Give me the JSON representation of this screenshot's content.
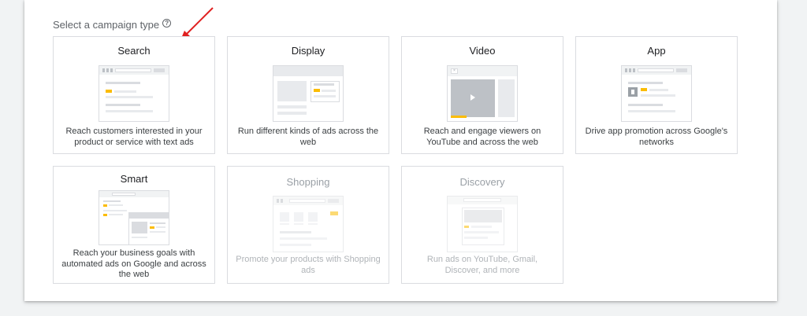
{
  "heading": "Select a campaign type",
  "colors": {
    "accent_yellow": "#fbbc04",
    "arrow_red": "#e02020",
    "border": "#dadce0",
    "disabled_text": "#9aa0a6"
  },
  "campaign_types": [
    {
      "title": "Search",
      "description": "Reach customers interested in your product or service with text ads",
      "icon": "search-ad-illustration",
      "enabled": true
    },
    {
      "title": "Display",
      "description": "Run different kinds of ads across the web",
      "icon": "display-ad-illustration",
      "enabled": true
    },
    {
      "title": "Video",
      "description": "Reach and engage viewers on YouTube and across the web",
      "icon": "video-ad-illustration",
      "enabled": true
    },
    {
      "title": "App",
      "description": "Drive app promotion across Google's networks",
      "icon": "app-ad-illustration",
      "enabled": true
    },
    {
      "title": "Smart",
      "description": "Reach your business goals with automated ads on Google and across the web",
      "icon": "smart-ad-illustration",
      "enabled": true
    },
    {
      "title": "Shopping",
      "description": "Promote your products with Shopping ads",
      "icon": "shopping-ad-illustration",
      "enabled": false
    },
    {
      "title": "Discovery",
      "description": "Run ads on YouTube, Gmail, Discover, and more",
      "icon": "discovery-ad-illustration",
      "enabled": false
    }
  ]
}
